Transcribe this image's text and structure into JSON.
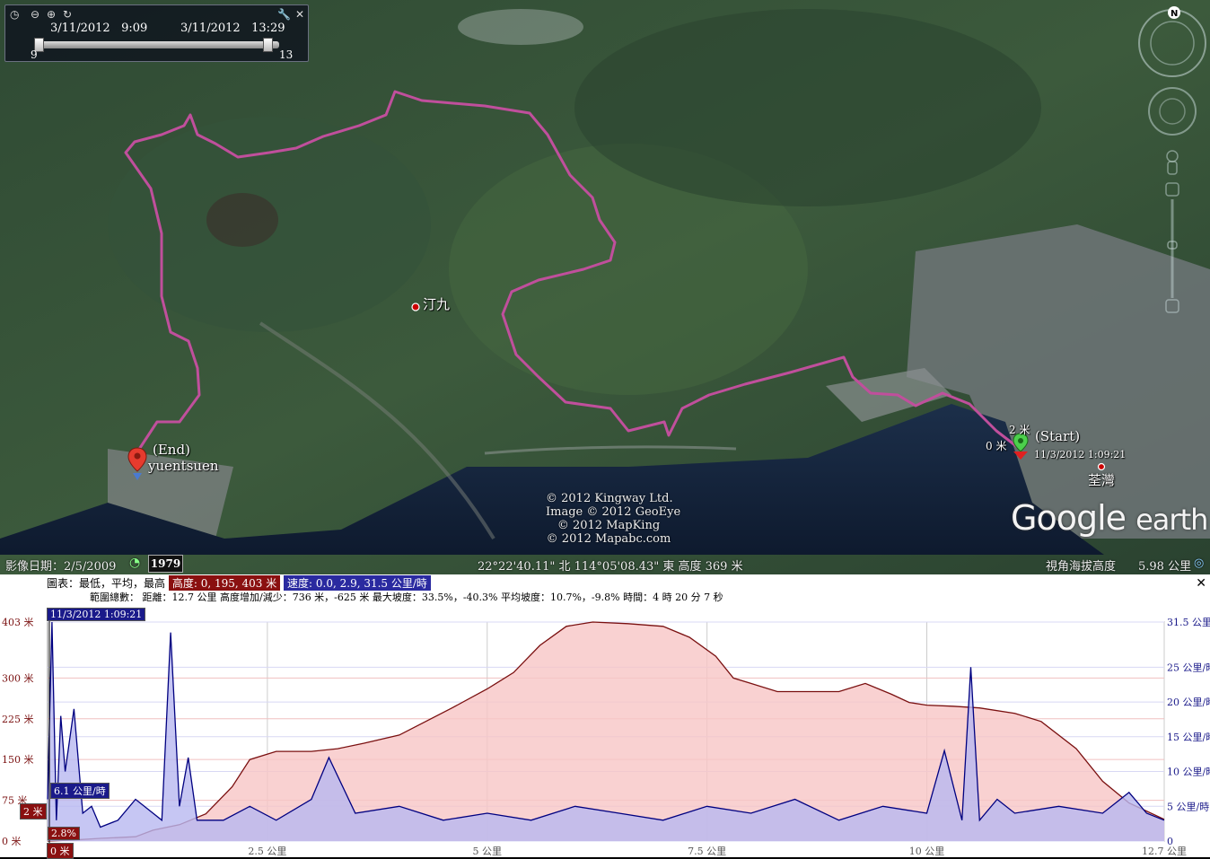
{
  "timebar": {
    "start_date": "3/11/2012",
    "start_time": "9:09",
    "end_date": "3/11/2012",
    "end_time": "13:29",
    "start_tick": "9",
    "end_tick": "13"
  },
  "map": {
    "place_label": "汀九",
    "place_label_2": "荃灣",
    "end_marker": {
      "title": "(End)",
      "name": "yuentsuen"
    },
    "start_marker": {
      "title": "(Start)",
      "timestamp": "11/3/2012 1:09:21",
      "height_label": "2 米",
      "zero_label": "0 米"
    },
    "copyright": [
      "© 2012 Kingway Ltd.",
      "Image © 2012 GeoEye",
      "© 2012 MapKing",
      "© 2012 Mapabc.com"
    ],
    "brand": {
      "google": "Google",
      "earth": "earth"
    }
  },
  "statusbar": {
    "imagery_date": "影像日期：2/5/2009",
    "historical_year": "1979",
    "coords": "22°22'40.11\" 北 114°05'08.43\" 東 高度  369 米",
    "eye_alt_label": "視角海拔高度",
    "eye_alt_value": "5.98 公里"
  },
  "profile": {
    "row1_label": "圖表：最低，平均，最高",
    "elev_badge": "高度: 0, 195, 403 米",
    "speed_badge": "速度: 0.0, 2.9, 31.5 公里/時",
    "row2_label": "範圍總數：",
    "row2_stats": "距離：12.7 公里 高度增加/減少：736 米，-625 米 最大坡度：33.5%，-40.3% 平均坡度：10.7%，-9.8% 時間：4 時 20 分 7 秒",
    "cursor_time": "11/3/2012 1:09:21",
    "cursor_speed": "6.1 公里/時",
    "cursor_elev": "2 米",
    "cursor_slope": "2.8%",
    "cursor_dist": "0 米",
    "close": "✕"
  },
  "chart_data": {
    "type": "area",
    "x_unit": "公里",
    "xlim": [
      0,
      12.7
    ],
    "x_ticks": [
      "2.5 公里",
      "5 公里",
      "7.5 公里",
      "10 公里",
      "12.7 公里"
    ],
    "x_tick_values": [
      2.5,
      5,
      7.5,
      10,
      12.7
    ],
    "y_left_ticks": [
      "403 米",
      "300 米",
      "225 米",
      "150 米",
      "75 米",
      "0 米"
    ],
    "y_right_ticks": [
      "31.5 公里/時",
      "25 公里/時",
      "20 公里/時",
      "15 公里/時",
      "10 公里/時",
      "5 公里/時",
      "0"
    ],
    "ylim_left": [
      0,
      403
    ],
    "ylim_right": [
      0,
      31.5
    ],
    "grid": true,
    "series": [
      {
        "name": "高度",
        "axis": "left",
        "color": "#7a1010",
        "fill": "#f8c6c6",
        "x": [
          0,
          0.3,
          0.6,
          1,
          1.2,
          1.5,
          1.8,
          2.1,
          2.3,
          2.6,
          3,
          3.3,
          3.6,
          4,
          4.3,
          4.6,
          5,
          5.3,
          5.6,
          5.9,
          6.2,
          6.6,
          7,
          7.3,
          7.6,
          7.8,
          8,
          8.3,
          8.6,
          9,
          9.3,
          9.6,
          9.8,
          10,
          10.3,
          10.6,
          11,
          11.3,
          11.7,
          12,
          12.3,
          12.7
        ],
        "values": [
          0,
          2,
          5,
          8,
          20,
          30,
          50,
          100,
          150,
          165,
          165,
          170,
          180,
          195,
          220,
          245,
          280,
          310,
          360,
          395,
          403,
          400,
          395,
          375,
          340,
          300,
          290,
          275,
          275,
          275,
          290,
          270,
          255,
          250,
          248,
          245,
          235,
          220,
          170,
          110,
          70,
          40
        ]
      },
      {
        "name": "速度",
        "axis": "right",
        "color": "#000080",
        "fill": "#b8b8f0",
        "x": [
          0,
          0.05,
          0.1,
          0.15,
          0.2,
          0.3,
          0.4,
          0.5,
          0.6,
          0.8,
          1,
          1.2,
          1.3,
          1.4,
          1.5,
          1.6,
          1.7,
          2.0,
          2.3,
          2.6,
          3,
          3.2,
          3.5,
          4,
          4.5,
          5,
          5.5,
          6,
          6.5,
          7,
          7.5,
          8,
          8.5,
          9,
          9.5,
          10,
          10.2,
          10.4,
          10.5,
          10.6,
          10.8,
          11,
          11.5,
          12,
          12.3,
          12.5,
          12.7
        ],
        "values": [
          6,
          31.5,
          3,
          18,
          10,
          19,
          4,
          5,
          2,
          3,
          6,
          4,
          3,
          30,
          5,
          12,
          3,
          3,
          5,
          3,
          6,
          12,
          4,
          5,
          3,
          4,
          3,
          5,
          4,
          3,
          5,
          4,
          6,
          3,
          5,
          4,
          13,
          3,
          25,
          3,
          6,
          4,
          5,
          4,
          7,
          4,
          3
        ]
      }
    ]
  }
}
